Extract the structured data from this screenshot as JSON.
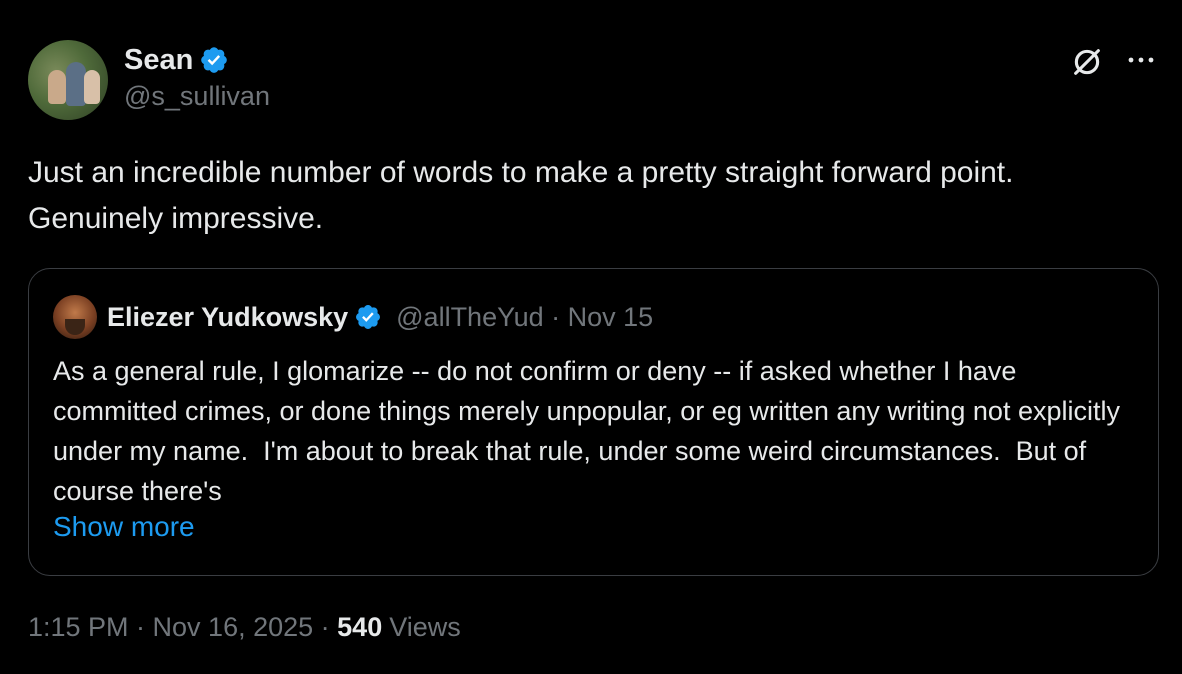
{
  "author": {
    "display_name": "Sean",
    "handle": "@s_sullivan",
    "verified": true
  },
  "icons": {
    "verified": "verified-badge-icon",
    "grok": "grok-slash-icon",
    "more": "more-horizontal-icon"
  },
  "tweet": {
    "text": "Just an incredible number of words to make a pretty straight forward point. Genuinely impressive."
  },
  "quote": {
    "display_name": "Eliezer Yudkowsky",
    "handle_date": "@allTheYud · Nov 15",
    "verified": true,
    "text": "As a general rule, I glomarize -- do not confirm or deny -- if asked whether I have committed crimes, or done things merely unpopular, or eg written any writing not explicitly under my name.  I'm about to break that rule, under some weird circumstances.  But of course there's",
    "show_more": "Show more"
  },
  "footer": {
    "time_date": "1:15 PM · Nov 16, 2025 · ",
    "views_count": "540",
    "views_label": "Views"
  },
  "colors": {
    "background": "#000000",
    "text_primary": "#e7e9ea",
    "text_secondary": "#71767b",
    "accent": "#1d9bf0",
    "border": "#3a3d42"
  }
}
